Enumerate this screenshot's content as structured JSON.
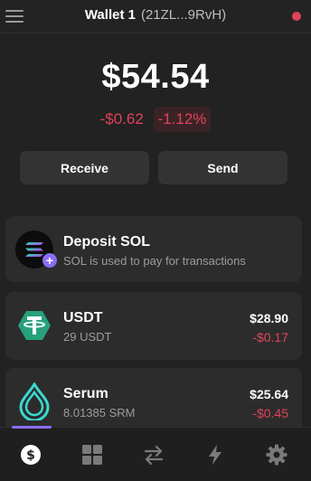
{
  "header": {
    "menu_icon": "hamburger-menu-icon",
    "wallet_name": "Wallet 1",
    "wallet_address": "(21ZL...9RvH)",
    "status_color": "#e0435a"
  },
  "portfolio": {
    "balance": "$54.54",
    "change_abs": "-$0.62",
    "change_pct": "-1.12%",
    "negative_color": "#e0435a"
  },
  "actions": {
    "receive_label": "Receive",
    "send_label": "Send"
  },
  "deposit": {
    "title": "Deposit SOL",
    "subtitle": "SOL is used to pay for transactions",
    "icon": "solana-logo-icon",
    "badge_icon": "plus-icon",
    "badge_text": "+"
  },
  "tokens": [
    {
      "name": "USDT",
      "amount": "29 USDT",
      "value": "$28.90",
      "change": "-$0.17",
      "icon": "tether-logo-icon"
    },
    {
      "name": "Serum",
      "amount": "8.01385 SRM",
      "value": "$25.64",
      "change": "-$0.45",
      "icon": "serum-logo-icon"
    }
  ],
  "nav": {
    "items": [
      "balances-icon",
      "collectibles-grid-icon",
      "swap-arrows-icon",
      "activity-bolt-icon",
      "settings-gear-icon"
    ],
    "active": "balances-icon",
    "accent_color": "#8c6cf7"
  }
}
